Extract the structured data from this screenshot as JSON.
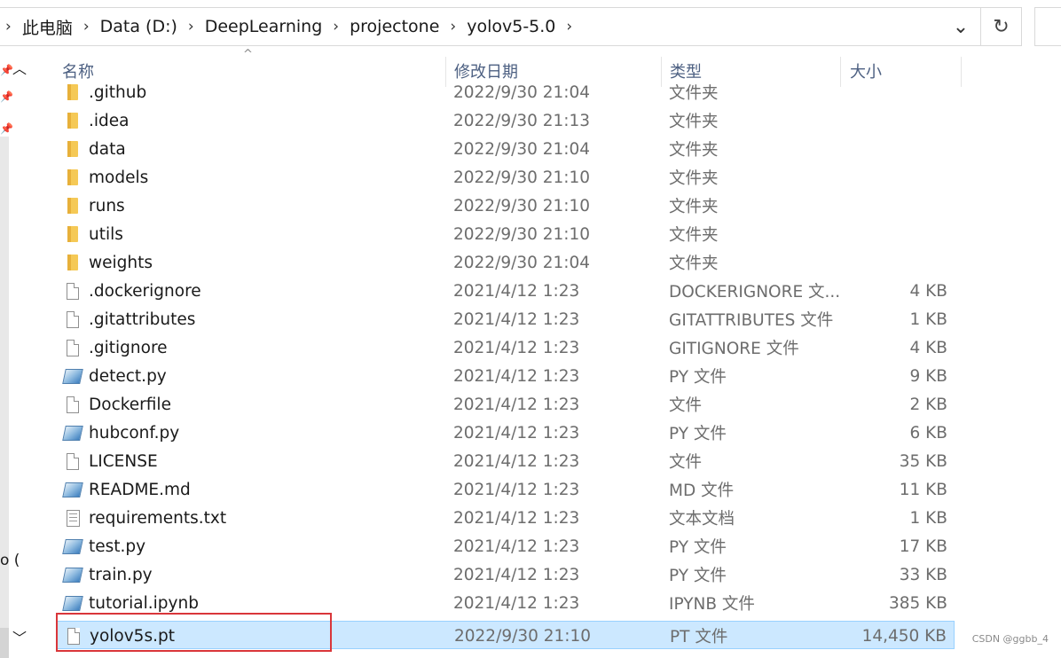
{
  "address_bar": {
    "breadcrumbs": [
      "此电脑",
      "Data (D:)",
      "DeepLearning",
      "projectone",
      "yolov5-5.0"
    ],
    "separator": "›",
    "dropdown_glyph": "⌄",
    "refresh_glyph": "↻"
  },
  "nav": {
    "fragment_text": "o ("
  },
  "columns": {
    "name": "名称",
    "date": "修改日期",
    "type": "类型",
    "size": "大小"
  },
  "files": [
    {
      "icon": "folder",
      "name": ".github",
      "date": "2022/9/30 21:04",
      "type": "文件夹",
      "size": ""
    },
    {
      "icon": "folder",
      "name": ".idea",
      "date": "2022/9/30 21:13",
      "type": "文件夹",
      "size": ""
    },
    {
      "icon": "folder",
      "name": "data",
      "date": "2022/9/30 21:04",
      "type": "文件夹",
      "size": ""
    },
    {
      "icon": "folder",
      "name": "models",
      "date": "2022/9/30 21:10",
      "type": "文件夹",
      "size": ""
    },
    {
      "icon": "folder",
      "name": "runs",
      "date": "2022/9/30 21:10",
      "type": "文件夹",
      "size": ""
    },
    {
      "icon": "folder",
      "name": "utils",
      "date": "2022/9/30 21:10",
      "type": "文件夹",
      "size": ""
    },
    {
      "icon": "folder",
      "name": "weights",
      "date": "2022/9/30 21:04",
      "type": "文件夹",
      "size": ""
    },
    {
      "icon": "doc",
      "name": ".dockerignore",
      "date": "2021/4/12 1:23",
      "type": "DOCKERIGNORE 文...",
      "size": "4 KB"
    },
    {
      "icon": "doc",
      "name": ".gitattributes",
      "date": "2021/4/12 1:23",
      "type": "GITATTRIBUTES 文件",
      "size": "1 KB"
    },
    {
      "icon": "doc",
      "name": ".gitignore",
      "date": "2021/4/12 1:23",
      "type": "GITIGNORE 文件",
      "size": "4 KB"
    },
    {
      "icon": "python",
      "name": "detect.py",
      "date": "2021/4/12 1:23",
      "type": "PY 文件",
      "size": "9 KB"
    },
    {
      "icon": "doc",
      "name": "Dockerfile",
      "date": "2021/4/12 1:23",
      "type": "文件",
      "size": "2 KB"
    },
    {
      "icon": "python",
      "name": "hubconf.py",
      "date": "2021/4/12 1:23",
      "type": "PY 文件",
      "size": "6 KB"
    },
    {
      "icon": "doc",
      "name": "LICENSE",
      "date": "2021/4/12 1:23",
      "type": "文件",
      "size": "35 KB"
    },
    {
      "icon": "python",
      "name": "README.md",
      "date": "2021/4/12 1:23",
      "type": "MD 文件",
      "size": "11 KB"
    },
    {
      "icon": "text",
      "name": "requirements.txt",
      "date": "2021/4/12 1:23",
      "type": "文本文档",
      "size": "1 KB"
    },
    {
      "icon": "python",
      "name": "test.py",
      "date": "2021/4/12 1:23",
      "type": "PY 文件",
      "size": "17 KB"
    },
    {
      "icon": "python",
      "name": "train.py",
      "date": "2021/4/12 1:23",
      "type": "PY 文件",
      "size": "33 KB"
    },
    {
      "icon": "python",
      "name": "tutorial.ipynb",
      "date": "2021/4/12 1:23",
      "type": "IPYNB 文件",
      "size": "385 KB"
    },
    {
      "icon": "doc",
      "name": "yolov5s.pt",
      "date": "2022/9/30 21:10",
      "type": "PT 文件",
      "size": "14,450 KB",
      "selected": true
    }
  ],
  "watermark": "CSDN @ggbb_4",
  "colors": {
    "selection_bg": "#cce8ff",
    "selection_border": "#99d1ff",
    "highlight": "#d9363a",
    "folder": "#f5c956",
    "header_text": "#4d6082"
  }
}
